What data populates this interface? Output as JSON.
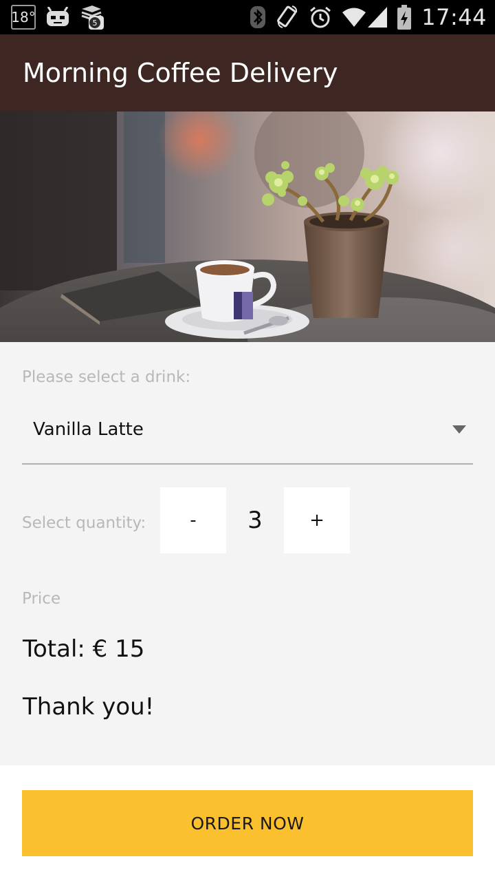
{
  "status_bar": {
    "temperature": "18°",
    "notification_count": "5",
    "time": "17:44",
    "icons": [
      "temperature-icon",
      "android-icon",
      "stack-notification-icon",
      "bluetooth-icon",
      "rotate-icon",
      "alarm-icon",
      "wifi-icon",
      "signal-icon",
      "battery-icon"
    ]
  },
  "app_bar": {
    "title": "Morning Coffee Delivery",
    "color": "#3e2723"
  },
  "hero": {
    "description": "coffee-cafe-photo"
  },
  "form": {
    "drink_label": "Please select a drink:",
    "drink_selected": "Vanilla Latte",
    "quantity_label": "Select quantity:",
    "decrement_label": "-",
    "quantity_value": "3",
    "increment_label": "+",
    "price_label": "Price",
    "total_text": "Total: € 15",
    "thanks_text": "Thank you!"
  },
  "order_button": {
    "label": "ORDER NOW",
    "color": "#fbc02d"
  }
}
